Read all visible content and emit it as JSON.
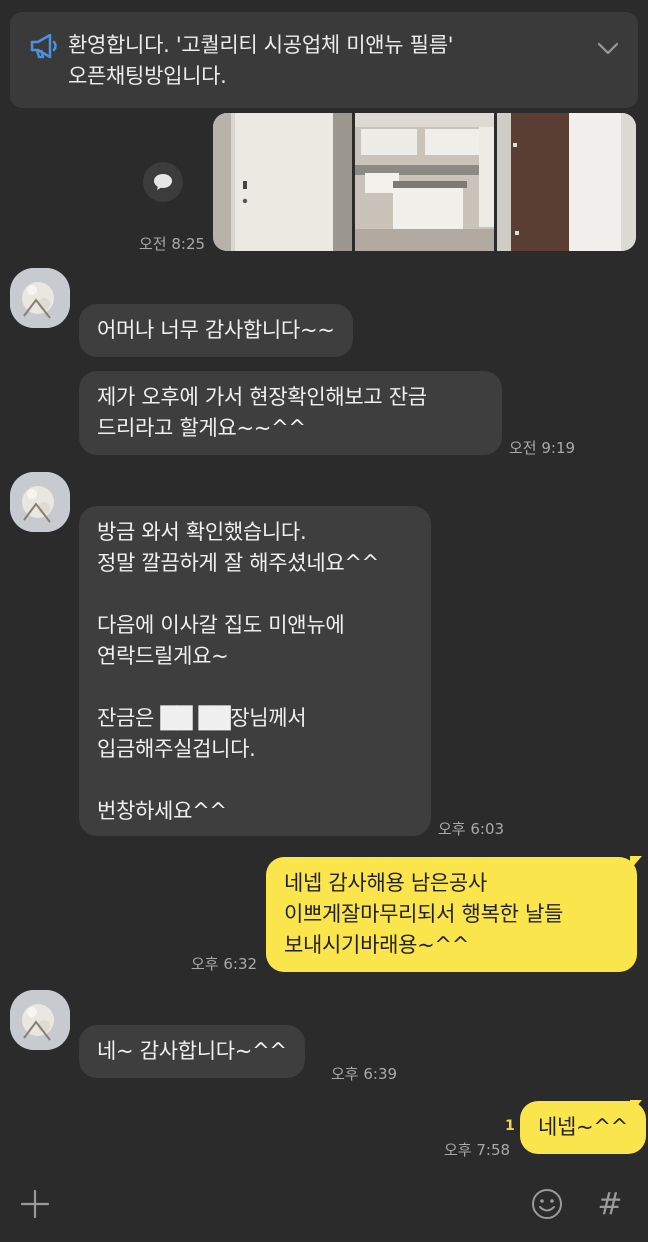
{
  "notice": {
    "text": "환영합니다. '고퀄리티 시공업체 미앤뉴 필름'\n오픈채팅방입니다.",
    "icon": "megaphone-icon",
    "toggle_icon": "chevron-down-icon"
  },
  "messages": [
    {
      "type": "photos",
      "sender": "me",
      "count": 3,
      "time": "오전 8:25"
    },
    {
      "type": "text",
      "sender": "other",
      "text": "어머나 너무 감사합니다~~"
    },
    {
      "type": "text",
      "sender": "other",
      "text": "제가 오후에 가서 현장확인해보고 잔금\n드리라고 할게요~~^^",
      "time": "오전 9:19"
    },
    {
      "type": "text",
      "sender": "other",
      "text": "방금 와서 확인했습니다.\n정말 깔끔하게 잘 해주셨네요^^\n\n다음에 이사갈 집도 미앤뉴에\n연락드릴게요~\n\n잔금은 ██ ██장님께서\n입금해주실겁니다.\n\n번창하세요^^",
      "time": "오후 6:03"
    },
    {
      "type": "text",
      "sender": "me",
      "text": "네넵 감사해용 남은공사\n이쁘게잘마무리되서 행복한 날들\n보내시기바래용~^^",
      "time": "오후 6:32"
    },
    {
      "type": "text",
      "sender": "other",
      "text": "네~ 감사합니다~^^",
      "time": "오후 6:39"
    },
    {
      "type": "text",
      "sender": "me",
      "text": "네넵~^^",
      "time": "오후 7:58",
      "unread": "1"
    }
  ],
  "input_bar": {
    "add_icon": "plus-icon",
    "emoji_icon": "emoji-icon",
    "hash_label": "#"
  },
  "colors": {
    "background": "#2b2b2b",
    "other_bubble": "#3e3e3e",
    "my_bubble": "#fbe54d",
    "unread": "#f2d84b"
  }
}
